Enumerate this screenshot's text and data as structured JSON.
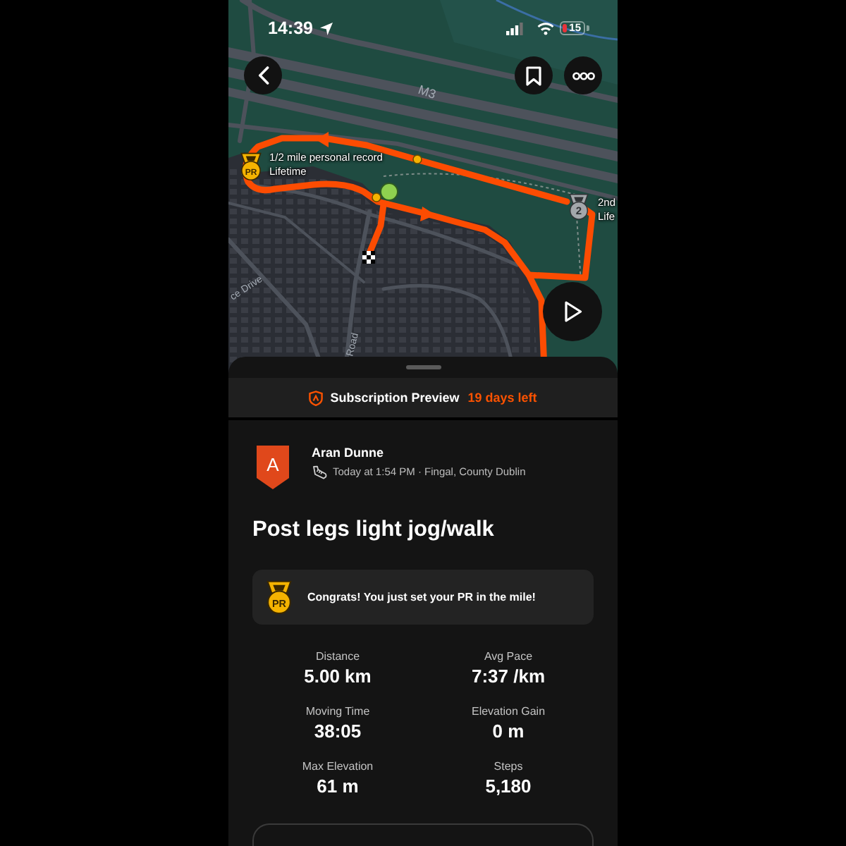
{
  "status_bar": {
    "time": "14:39",
    "battery": "15"
  },
  "map": {
    "road_labels": [
      "M3",
      "ce Drive",
      "Road"
    ],
    "achievements": [
      {
        "kind": "pr",
        "medal": "PR",
        "title": "1/2 mile personal record",
        "subtitle": "Lifetime"
      },
      {
        "kind": "place",
        "medal": "2",
        "title": "2nd",
        "subtitle": "Life"
      }
    ]
  },
  "subscription_banner": {
    "label": "Subscription Preview",
    "remaining": "19 days left"
  },
  "athlete": {
    "initial": "A",
    "name": "Aran Dunne",
    "meta": "Today at 1:54 PM · Fingal, County Dublin"
  },
  "activity_title": "Post legs light jog/walk",
  "achievement_banner": {
    "kind": "pr",
    "medal": "PR",
    "text": "Congrats! You just set your PR in the mile!"
  },
  "stats": [
    {
      "label": "Distance",
      "value": "5.00 km"
    },
    {
      "label": "Avg Pace",
      "value": "7:37 /km"
    },
    {
      "label": "Moving Time",
      "value": "38:05"
    },
    {
      "label": "Elevation Gain",
      "value": "0 m"
    },
    {
      "label": "Max Elevation",
      "value": "61 m"
    },
    {
      "label": "Steps",
      "value": "5,180"
    }
  ]
}
